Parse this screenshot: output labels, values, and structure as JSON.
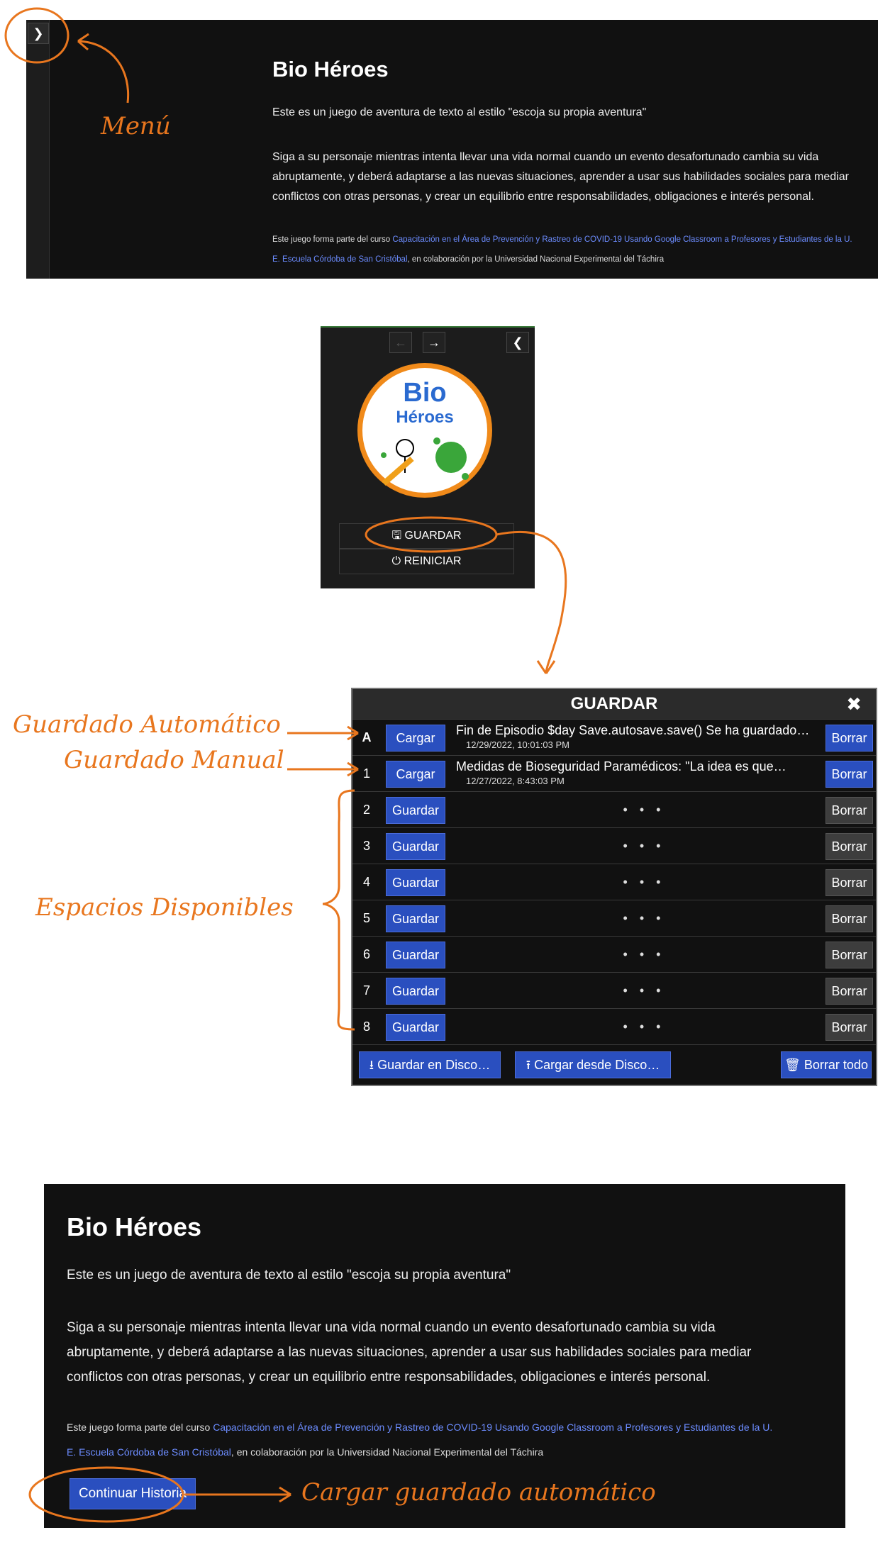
{
  "story": {
    "title": "Bio Héroes",
    "intro": "Este es un juego de aventura de texto al estilo \"escoja su propia aventura\"",
    "para_line1": "Siga a su personaje mientras intenta llevar una vida normal cuando un evento desafortunado cambia su vida",
    "para_line2": "abruptamente, y deberá adaptarse a las nuevas situaciones, aprender a usar sus habilidades sociales para mediar",
    "para_line3": "conflictos con otras personas, y crear un equilibrio entre responsabilidades, obligaciones e interés personal.",
    "credits_prefix": "Este juego forma parte del curso ",
    "credits_link_line1": "Capacitación en el Área de Prevención y Rastreo de COVID-19 Usando Google Classroom a Profesores y Estudiantes de la U.",
    "credits_link_line2": "E. Escuela Córdoba de San Cristóbal",
    "credits_suffix": ", en colaboración por la Universidad Nacional Experimental del Táchira",
    "continue_label": "Continuar Historia"
  },
  "sidebar": {
    "logo_line1": "Bio",
    "logo_line2": "Héroes",
    "save_label": "GUARDAR",
    "restart_label": "REINICIAR"
  },
  "dialog": {
    "title": "GUARDAR",
    "load_label": "Cargar",
    "save_label": "Guardar",
    "delete_label": "Borrar",
    "empty_text": "• • •",
    "slots": [
      {
        "id": "A",
        "title": "Fin de Episodio $day Save.autosave.save() Se ha guardado…",
        "date": "12/29/2022, 10:01:03 PM"
      },
      {
        "id": "1",
        "title": "Medidas de Bioseguridad Paramédicos: \"La idea es que…",
        "date": "12/27/2022, 8:43:03 PM"
      },
      {
        "id": "2"
      },
      {
        "id": "3"
      },
      {
        "id": "4"
      },
      {
        "id": "5"
      },
      {
        "id": "6"
      },
      {
        "id": "7"
      },
      {
        "id": "8"
      }
    ],
    "save_disk_label": "Guardar en Disco…",
    "load_disk_label": "Cargar desde Disco…",
    "delete_all_label": "Borrar todo"
  },
  "annotations": {
    "menu": "Menú",
    "autosave": "Guardado Automático",
    "manual": "Guardado Manual",
    "available": "Espacios Disponibles",
    "load_auto": "Cargar guardado automático"
  },
  "colors": {
    "accent": "#e8761e",
    "button_blue": "#2a4fbf",
    "link": "#6c8cff"
  }
}
